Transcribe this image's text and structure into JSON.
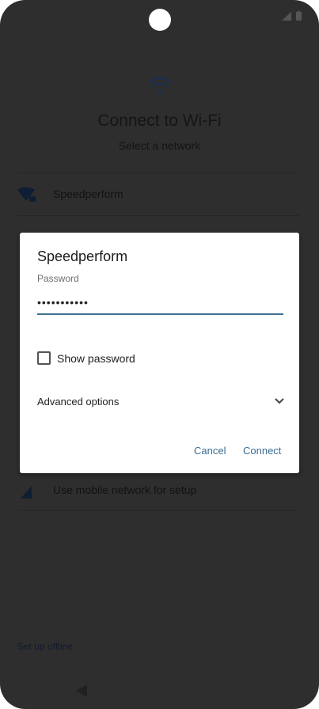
{
  "header": {
    "title": "Connect to Wi-Fi",
    "subtitle": "Select a network"
  },
  "networks": [
    {
      "label": "Speedperform",
      "icon": "wifi-lock-icon"
    },
    {
      "label": "Use mobile network for setup",
      "icon": "cellular-icon"
    }
  ],
  "footer": {
    "setup_offline": "Set up offline"
  },
  "dialog": {
    "title": "Speedperform",
    "password_label": "Password",
    "password_value": "•••••••••••",
    "show_password_label": "Show password",
    "show_password_checked": false,
    "advanced_label": "Advanced options",
    "cancel_label": "Cancel",
    "connect_label": "Connect"
  },
  "colors": {
    "accent": "#3a6d91",
    "scrim": "#2e2e2e",
    "dialog_bg": "#ffffff"
  }
}
